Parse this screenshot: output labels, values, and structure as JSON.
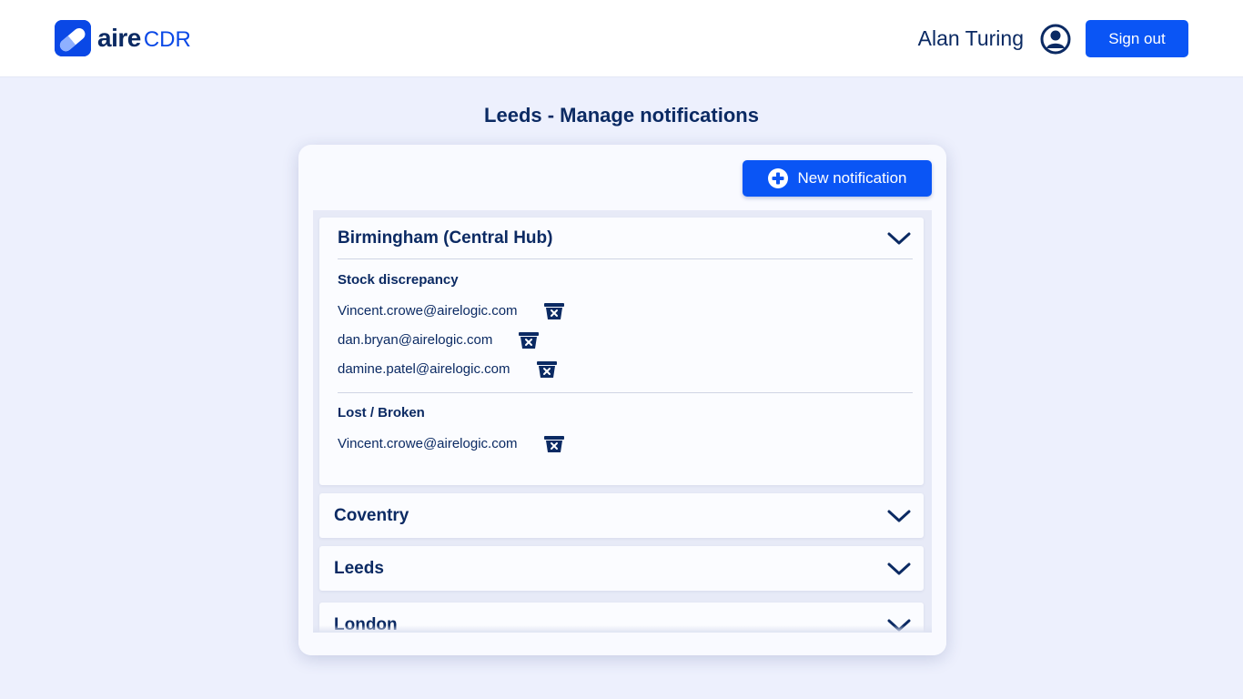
{
  "header": {
    "logo_bold": "aire",
    "logo_light": "CDR",
    "user_name": "Alan Turing",
    "sign_out_label": "Sign out"
  },
  "page": {
    "title_prefix": "Leeds - ",
    "title_main": "Manage notifications"
  },
  "toolbar": {
    "new_notification_label": "New notification"
  },
  "locations": [
    {
      "name": "Birmingham (Central Hub)",
      "expanded": true,
      "groups": [
        {
          "title": "Stock discrepancy",
          "emails": [
            "Vincent.crowe@airelogic.com",
            "dan.bryan@airelogic.com",
            "damine.patel@airelogic.com"
          ]
        },
        {
          "title": "Lost / Broken",
          "emails": [
            "Vincent.crowe@airelogic.com"
          ]
        }
      ]
    },
    {
      "name": "Coventry",
      "expanded": false
    },
    {
      "name": "Leeds",
      "expanded": false
    },
    {
      "name": "London",
      "expanded": false
    }
  ],
  "colors": {
    "brand_blue": "#0a55f5",
    "navy": "#0b2a63",
    "background": "#edf0fd"
  },
  "icons": {
    "logo": "pill-icon",
    "user": "user-circle-icon",
    "add": "plus-circle-icon",
    "delete": "delete-box-icon",
    "expand": "chevron-down-icon"
  }
}
